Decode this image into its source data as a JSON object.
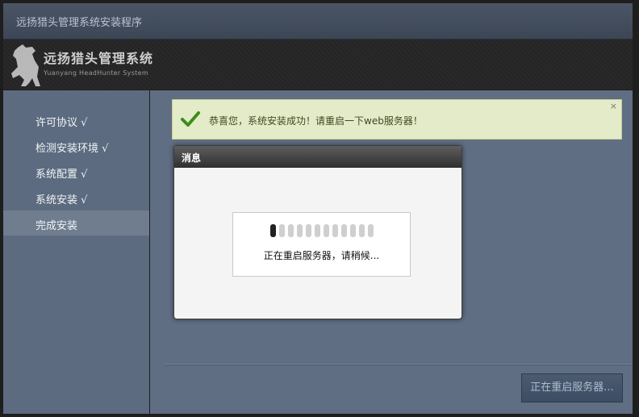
{
  "window": {
    "title": "远扬猎头管理系统安装程序"
  },
  "banner": {
    "brand_name": "远扬猎头管理系统",
    "brand_en": "Yuanyang HeadHunter System",
    "logo_icon": "horse-icon"
  },
  "sidebar": {
    "items": [
      {
        "label": "许可协议 √",
        "active": false
      },
      {
        "label": "检测安装环境 √",
        "active": false
      },
      {
        "label": "系统配置 √",
        "active": false
      },
      {
        "label": "系统安装 √",
        "active": false
      },
      {
        "label": "完成安装",
        "active": true
      }
    ]
  },
  "main": {
    "success_message": "恭喜您，系统安装成功！请重启一下web服务器！",
    "close_symbol": "×",
    "restart_button_label": "正在重启服务器..."
  },
  "dialog": {
    "title": "消息",
    "loading_text": "正在重启服务器，请稍候...",
    "loader_segments": 12,
    "loader_active_index": 0
  },
  "colors": {
    "sidebar_bg": "#5c6b7f",
    "success_bg": "#e4ebc8",
    "check_green": "#3c8c1c",
    "dialog_header": "#2f2f2f"
  }
}
